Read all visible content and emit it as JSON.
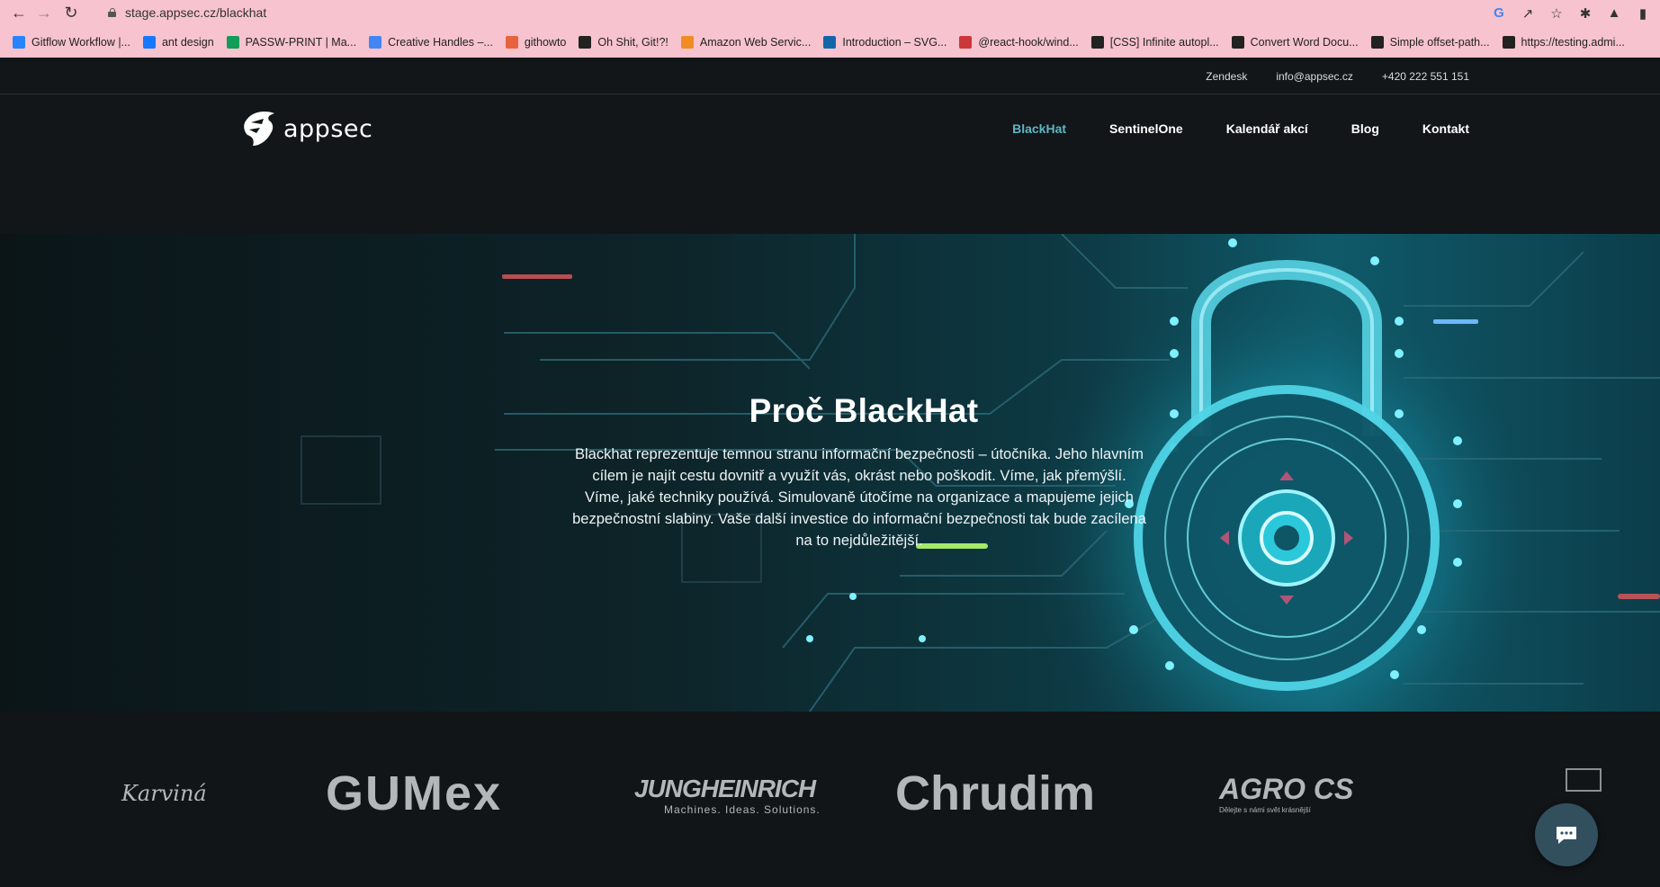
{
  "browser": {
    "url": "stage.appsec.cz/blackhat",
    "bookmarks": [
      {
        "label": "Gitflow Workflow |...",
        "icon": "atlassian-icon",
        "color": "#2684ff"
      },
      {
        "label": "ant design",
        "icon": "antd-icon",
        "color": "#1677ff"
      },
      {
        "label": "PASSW-PRINT | Ma...",
        "icon": "sheets-icon",
        "color": "#0f9d58"
      },
      {
        "label": "Creative Handles –...",
        "icon": "calendar-icon",
        "color": "#4285f4"
      },
      {
        "label": "githowto",
        "icon": "githowto-icon",
        "color": "#e8633b"
      },
      {
        "label": "Oh Shit, Git!?!",
        "icon": "ohshit-icon",
        "color": "#222222"
      },
      {
        "label": "Amazon Web Servic...",
        "icon": "aws-icon",
        "color": "#f08c22"
      },
      {
        "label": "Introduction – SVG...",
        "icon": "w3-icon",
        "color": "#1166aa"
      },
      {
        "label": "@react-hook/wind...",
        "icon": "npm-icon",
        "color": "#cb3837"
      },
      {
        "label": "[CSS] Infinite autopl...",
        "icon": "codepen-icon",
        "color": "#222222"
      },
      {
        "label": "Convert Word Docu...",
        "icon": "globe-icon",
        "color": "#222222"
      },
      {
        "label": "Simple offset-path...",
        "icon": "codepen-icon",
        "color": "#222222"
      },
      {
        "label": "https://testing.admi...",
        "icon": "globe-icon",
        "color": "#222222"
      }
    ]
  },
  "topbar": {
    "zendesk": "Zendesk",
    "email": "info@appsec.cz",
    "phone": "+420 222 551 151"
  },
  "header": {
    "logo_text": "appsec",
    "nav": [
      {
        "label": "BlackHat",
        "active": true
      },
      {
        "label": "SentinelOne",
        "active": false
      },
      {
        "label": "Kalendář akcí",
        "active": false
      },
      {
        "label": "Blog",
        "active": false
      },
      {
        "label": "Kontakt",
        "active": false
      }
    ]
  },
  "hero": {
    "title": "Proč BlackHat",
    "text": "Blackhat reprezentuje temnou stranu informační bezpečnosti – útočníka. Jeho hlavním cílem je najít cestu dovnitř a využít vás, okrást nebo poškodit. Víme, jak přemýšlí. Víme, jaké techniky používá. Simulovaně útočíme na organizace a mapujeme jejich bezpečnostní slabiny. Vaše další investice do informační bezpečnosti tak bude zacílena na to nejdůležitější."
  },
  "clients": {
    "karvina": "Karviná",
    "gumex": "GUMex",
    "jungheinrich": "JUNGHEINRICH",
    "jungheinrich_tagline": "Machines. Ideas. Solutions.",
    "chrudim": "Chrudim",
    "agro": "AGRO CS",
    "agro_tagline": "Dělejte s námi svět krásnější"
  }
}
